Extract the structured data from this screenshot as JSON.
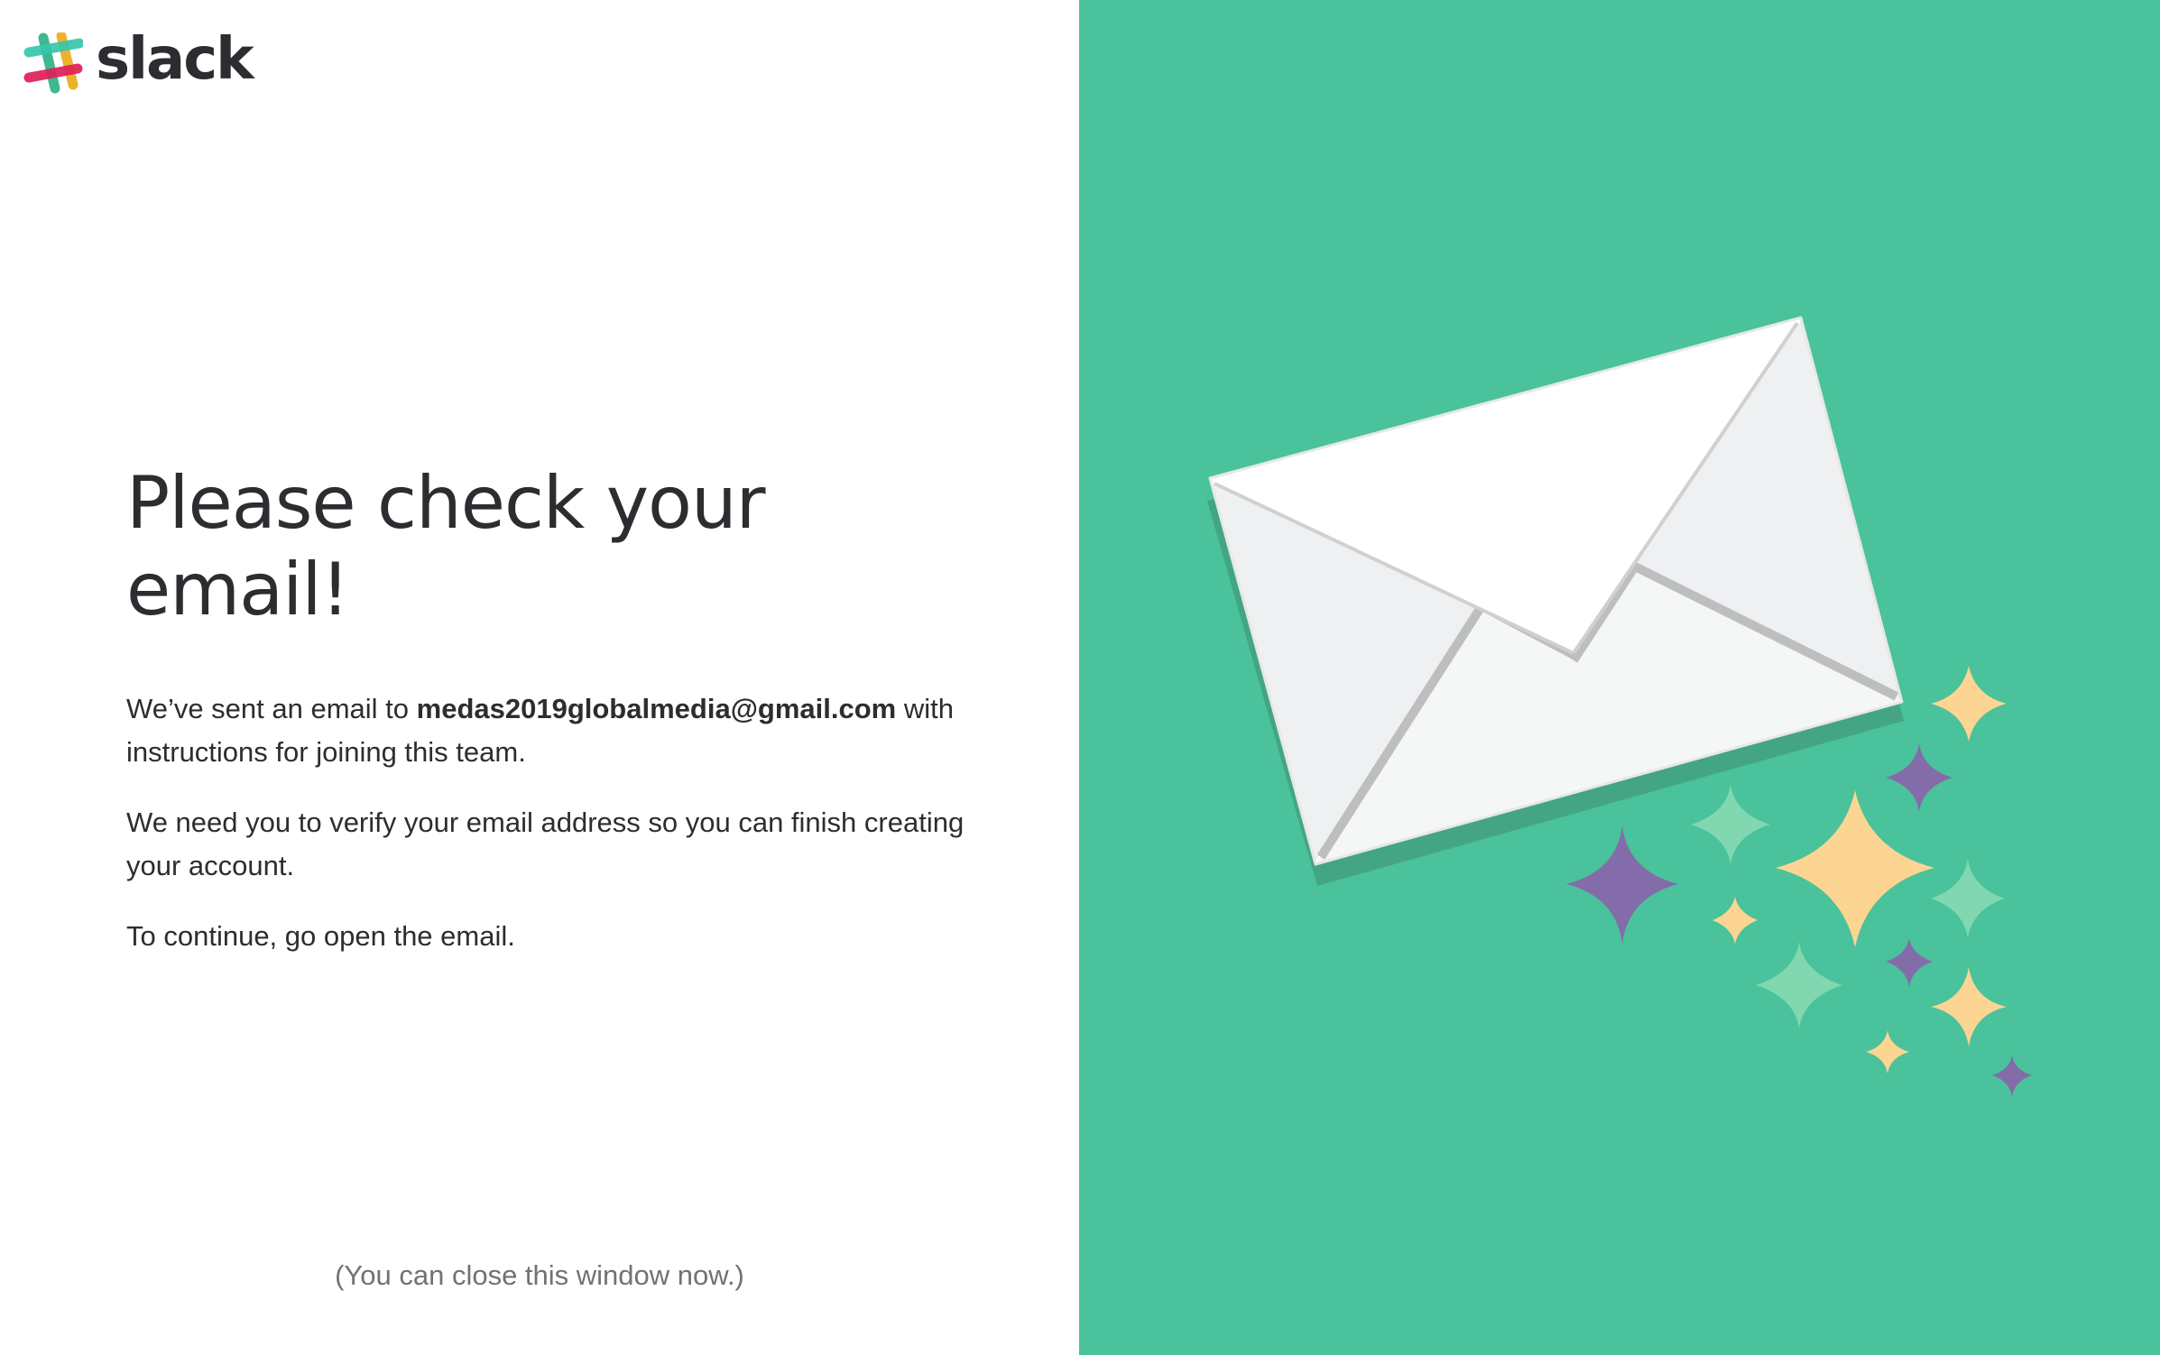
{
  "brand": {
    "wordmark": "slack",
    "colors": {
      "teal": "#36c5ab",
      "yellow": "#ecb22e",
      "pink": "#e01e5a",
      "green": "#3eb890",
      "text": "#2c2d30",
      "panel": "#4ac29b"
    }
  },
  "main": {
    "headline": "Please check your email!",
    "sent_prefix": "We’ve sent an email to ",
    "email": "medas2019globalmedia@gmail.com",
    "sent_suffix": " with instructions for joining this team.",
    "verify_text": "We need you to verify your email address so you can finish creating your account.",
    "continue_text": "To continue, go open the email.",
    "close_note": "(You can close this window now.)"
  },
  "illustration": {
    "icons": [
      "envelope-icon",
      "sparkle-icon"
    ],
    "colors": {
      "envelope": "#ffffff",
      "envelope_shade": "#eff0f1",
      "sparkle_yellow": "#fdd592",
      "sparkle_purple": "#836ca9",
      "sparkle_mint": "#80d7b0"
    }
  }
}
